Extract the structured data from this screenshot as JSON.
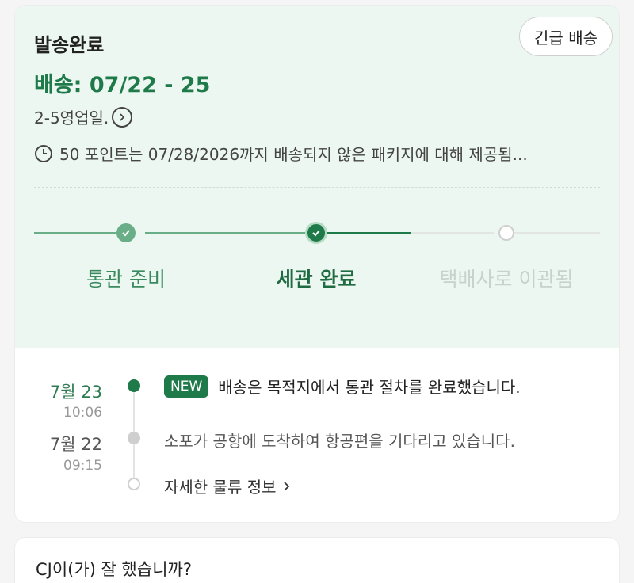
{
  "shipment": {
    "status_title": "발송완료",
    "urgent_button": "긴급 배송",
    "eta": "배송: 07/22 - 25",
    "business_days": "2-5영업일.",
    "points_notice": "50 포인트는 07/28/2026까지 배송되지 않은 패키지에 대해 제공됨..."
  },
  "progress": {
    "steps": [
      {
        "label": "통관 준비",
        "state": "done"
      },
      {
        "label": "세관 완료",
        "state": "current"
      },
      {
        "label": "택배사로 이관됨",
        "state": "pending"
      }
    ]
  },
  "timeline": {
    "events": [
      {
        "date": "7월 23",
        "time": "10:06",
        "badge": "NEW",
        "text": "배송은 목적지에서 통관 절차를 완료했습니다."
      },
      {
        "date": "7월 22",
        "time": "09:15",
        "text": "소포가 공항에 도착하여 항공편을 기다리고 있습니다."
      }
    ],
    "more_link": "자세한 물류 정보"
  },
  "review": {
    "question": "CJ이(가) 잘 했습니까?"
  },
  "colors": {
    "accent": "#1f7a4a",
    "panel_bg": "#edf7f1"
  }
}
